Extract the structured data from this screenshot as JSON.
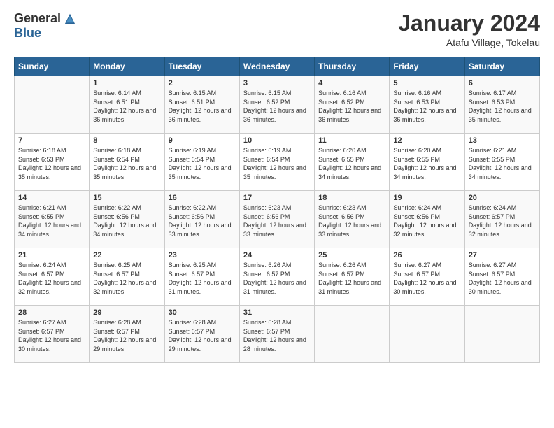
{
  "logo": {
    "general": "General",
    "blue": "Blue"
  },
  "title": "January 2024",
  "location": "Atafu Village, Tokelau",
  "days_of_week": [
    "Sunday",
    "Monday",
    "Tuesday",
    "Wednesday",
    "Thursday",
    "Friday",
    "Saturday"
  ],
  "weeks": [
    [
      {
        "day": "",
        "sunrise": "",
        "sunset": "",
        "daylight": ""
      },
      {
        "day": "1",
        "sunrise": "6:14 AM",
        "sunset": "6:51 PM",
        "daylight": "12 hours and 36 minutes."
      },
      {
        "day": "2",
        "sunrise": "6:15 AM",
        "sunset": "6:51 PM",
        "daylight": "12 hours and 36 minutes."
      },
      {
        "day": "3",
        "sunrise": "6:15 AM",
        "sunset": "6:52 PM",
        "daylight": "12 hours and 36 minutes."
      },
      {
        "day": "4",
        "sunrise": "6:16 AM",
        "sunset": "6:52 PM",
        "daylight": "12 hours and 36 minutes."
      },
      {
        "day": "5",
        "sunrise": "6:16 AM",
        "sunset": "6:53 PM",
        "daylight": "12 hours and 36 minutes."
      },
      {
        "day": "6",
        "sunrise": "6:17 AM",
        "sunset": "6:53 PM",
        "daylight": "12 hours and 35 minutes."
      }
    ],
    [
      {
        "day": "7",
        "sunrise": "6:18 AM",
        "sunset": "6:53 PM",
        "daylight": "12 hours and 35 minutes."
      },
      {
        "day": "8",
        "sunrise": "6:18 AM",
        "sunset": "6:54 PM",
        "daylight": "12 hours and 35 minutes."
      },
      {
        "day": "9",
        "sunrise": "6:19 AM",
        "sunset": "6:54 PM",
        "daylight": "12 hours and 35 minutes."
      },
      {
        "day": "10",
        "sunrise": "6:19 AM",
        "sunset": "6:54 PM",
        "daylight": "12 hours and 35 minutes."
      },
      {
        "day": "11",
        "sunrise": "6:20 AM",
        "sunset": "6:55 PM",
        "daylight": "12 hours and 34 minutes."
      },
      {
        "day": "12",
        "sunrise": "6:20 AM",
        "sunset": "6:55 PM",
        "daylight": "12 hours and 34 minutes."
      },
      {
        "day": "13",
        "sunrise": "6:21 AM",
        "sunset": "6:55 PM",
        "daylight": "12 hours and 34 minutes."
      }
    ],
    [
      {
        "day": "14",
        "sunrise": "6:21 AM",
        "sunset": "6:55 PM",
        "daylight": "12 hours and 34 minutes."
      },
      {
        "day": "15",
        "sunrise": "6:22 AM",
        "sunset": "6:56 PM",
        "daylight": "12 hours and 34 minutes."
      },
      {
        "day": "16",
        "sunrise": "6:22 AM",
        "sunset": "6:56 PM",
        "daylight": "12 hours and 33 minutes."
      },
      {
        "day": "17",
        "sunrise": "6:23 AM",
        "sunset": "6:56 PM",
        "daylight": "12 hours and 33 minutes."
      },
      {
        "day": "18",
        "sunrise": "6:23 AM",
        "sunset": "6:56 PM",
        "daylight": "12 hours and 33 minutes."
      },
      {
        "day": "19",
        "sunrise": "6:24 AM",
        "sunset": "6:56 PM",
        "daylight": "12 hours and 32 minutes."
      },
      {
        "day": "20",
        "sunrise": "6:24 AM",
        "sunset": "6:57 PM",
        "daylight": "12 hours and 32 minutes."
      }
    ],
    [
      {
        "day": "21",
        "sunrise": "6:24 AM",
        "sunset": "6:57 PM",
        "daylight": "12 hours and 32 minutes."
      },
      {
        "day": "22",
        "sunrise": "6:25 AM",
        "sunset": "6:57 PM",
        "daylight": "12 hours and 32 minutes."
      },
      {
        "day": "23",
        "sunrise": "6:25 AM",
        "sunset": "6:57 PM",
        "daylight": "12 hours and 31 minutes."
      },
      {
        "day": "24",
        "sunrise": "6:26 AM",
        "sunset": "6:57 PM",
        "daylight": "12 hours and 31 minutes."
      },
      {
        "day": "25",
        "sunrise": "6:26 AM",
        "sunset": "6:57 PM",
        "daylight": "12 hours and 31 minutes."
      },
      {
        "day": "26",
        "sunrise": "6:27 AM",
        "sunset": "6:57 PM",
        "daylight": "12 hours and 30 minutes."
      },
      {
        "day": "27",
        "sunrise": "6:27 AM",
        "sunset": "6:57 PM",
        "daylight": "12 hours and 30 minutes."
      }
    ],
    [
      {
        "day": "28",
        "sunrise": "6:27 AM",
        "sunset": "6:57 PM",
        "daylight": "12 hours and 30 minutes."
      },
      {
        "day": "29",
        "sunrise": "6:28 AM",
        "sunset": "6:57 PM",
        "daylight": "12 hours and 29 minutes."
      },
      {
        "day": "30",
        "sunrise": "6:28 AM",
        "sunset": "6:57 PM",
        "daylight": "12 hours and 29 minutes."
      },
      {
        "day": "31",
        "sunrise": "6:28 AM",
        "sunset": "6:57 PM",
        "daylight": "12 hours and 28 minutes."
      },
      {
        "day": "",
        "sunrise": "",
        "sunset": "",
        "daylight": ""
      },
      {
        "day": "",
        "sunrise": "",
        "sunset": "",
        "daylight": ""
      },
      {
        "day": "",
        "sunrise": "",
        "sunset": "",
        "daylight": ""
      }
    ]
  ],
  "labels": {
    "sunrise_prefix": "Sunrise: ",
    "sunset_prefix": "Sunset: ",
    "daylight_prefix": "Daylight: "
  }
}
